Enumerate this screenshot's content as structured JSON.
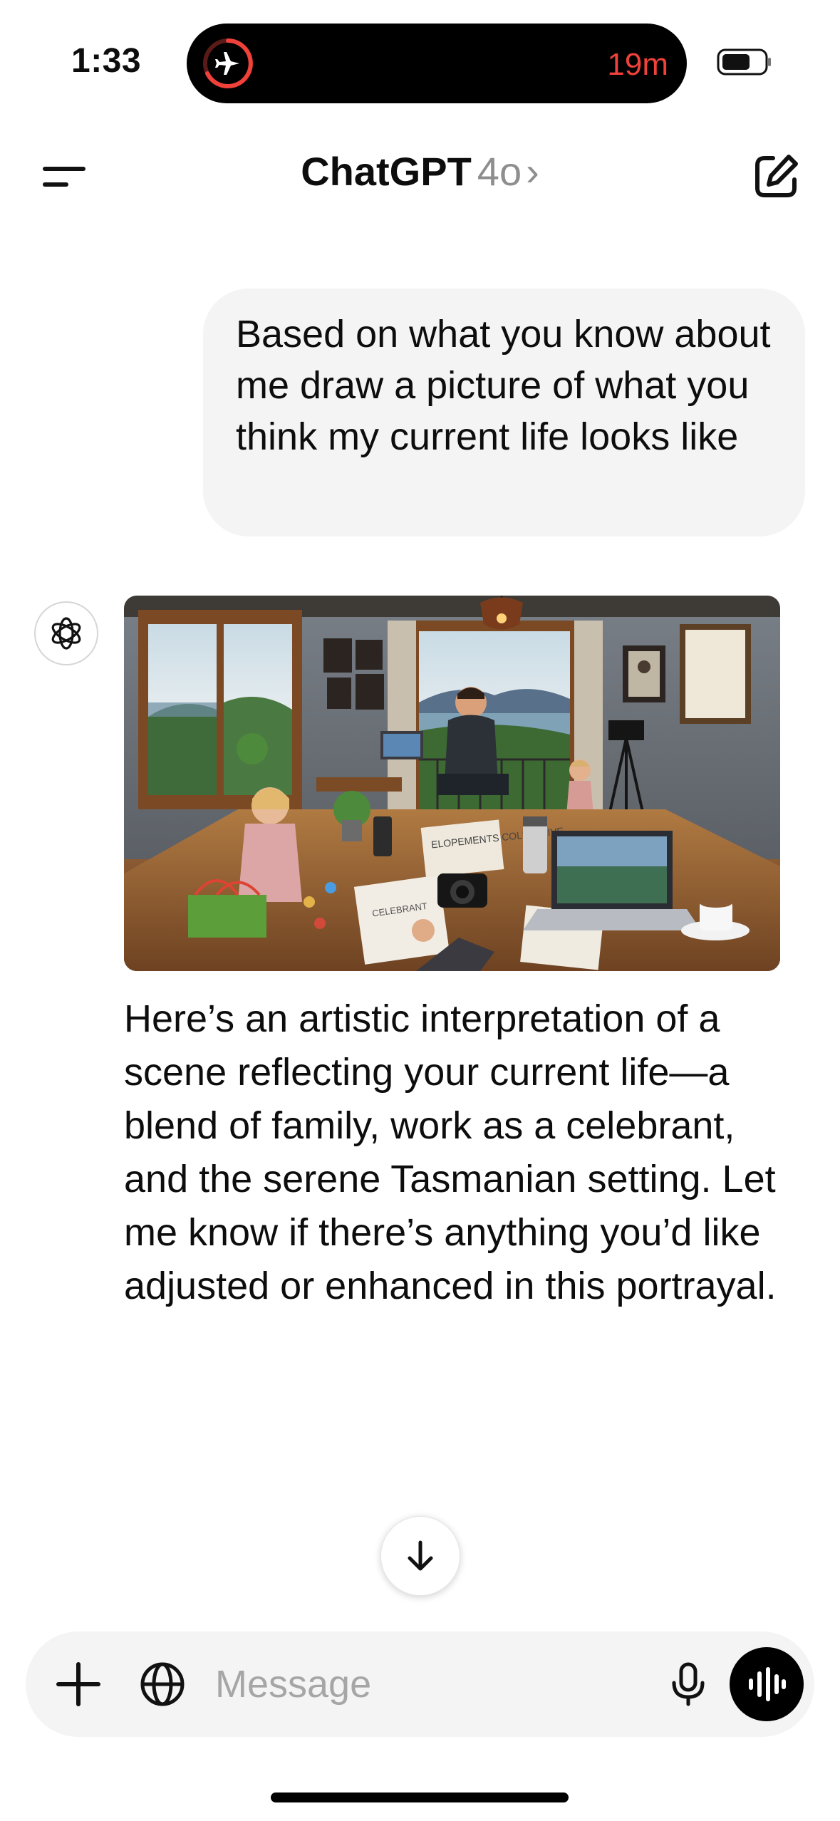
{
  "status_bar": {
    "time": "1:33",
    "island_timer": "19m",
    "island_icon": "airplane-icon",
    "battery_icon": "battery-icon"
  },
  "header": {
    "title": "ChatGPT",
    "model": "4o",
    "chevron": "›",
    "menu_icon": "menu-icon",
    "new_chat_icon": "new-chat-icon"
  },
  "messages": {
    "user": {
      "text": "Based on what you know about me draw a picture of what you think my current life looks like"
    },
    "assistant": {
      "avatar_icon": "openai-logo-icon",
      "image_label": "ELOPEMENTS COLLECTIVE",
      "image_label_2": "CELEBRANT",
      "text": "Here’s an artistic interpretation of a scene reflecting your current life—a blend of family, work as a celebrant, and the serene Tasmanian setting. Let me know if there’s anything you’d like adjusted or enhanced in this portrayal."
    }
  },
  "composer": {
    "placeholder": "Message",
    "plus_icon": "plus-icon",
    "globe_icon": "globe-icon",
    "mic_icon": "microphone-icon",
    "voice_icon": "voice-mode-icon"
  },
  "colors": {
    "island_accent": "#f0413a",
    "bubble_bg": "#f4f4f4",
    "text": "#0d0d0d",
    "muted": "#8e8e8e"
  }
}
